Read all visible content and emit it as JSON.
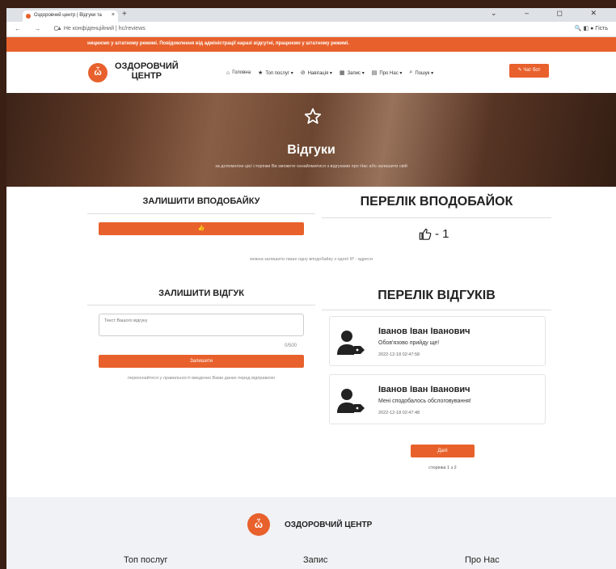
{
  "browser": {
    "tab_title": "Оздоровчий центр | Відгуки та",
    "tab_close": "×",
    "new_tab": "+",
    "window_controls": "⌄ – ◻ ✕",
    "nav_icons": "← → C",
    "url_text": "▲ Не конфіденційний | hc/reviews",
    "right_icons": "🔍 ◧ ● Гість"
  },
  "notice": {
    "text": "ницюємо у штатному режимі.   Повідомлення від адміністрації наразі відсутні, працюємо у штатному режимі."
  },
  "header": {
    "logo_text_line1": "ОЗДОРОВЧИЙ",
    "logo_text_line2": "ЦЕНТР",
    "menu": [
      {
        "icon": "⌂",
        "label": "Головна"
      },
      {
        "icon": "★",
        "label": "Топ послуг ▾"
      },
      {
        "icon": "⊘",
        "label": "Навігація ▾"
      },
      {
        "icon": "▦",
        "label": "Запис ▾"
      },
      {
        "icon": "▤",
        "label": "Про Нас ▾"
      },
      {
        "icon": "⌕",
        "label": "Пошук ▾"
      }
    ],
    "chat_button": "✎ Чат бот"
  },
  "hero": {
    "title": "Відгуки",
    "subtitle": "за допомогою цієї сторінки Ви зможете ознайомитися з відгуками про Нас або залишити свій"
  },
  "likes": {
    "leave_title": "ЗАЛИШИТИ ВПОДОБАЙКУ",
    "list_title": "ПЕРЕЛІК ВПОДОБАЙОК",
    "like_button_icon": "👍",
    "count": "- 1",
    "note": "можна залишити лише одну вподобайку з одної IP - адреси"
  },
  "review_form": {
    "title": "ЗАЛИШИТИ ВІДГУК",
    "placeholder": "Текст Вашого відгуку",
    "counter": "0/500",
    "submit": "Залишити",
    "note": "переконайтеся у правильності введених Вами даних перед відправкою"
  },
  "reviews": {
    "title": "ПЕРЕЛІК ВІДГУКІВ",
    "items": [
      {
        "name": "Іванов Іван Іванович",
        "text": "Обов'язово прийду ще!",
        "date": "2022-12-18 02:47:58"
      },
      {
        "name": "Іванов Іван Іванович",
        "text": "Мені сподобалось обслоговування!",
        "date": "2022-12-18 02:47:48"
      }
    ],
    "more_button": "Далі",
    "pager": "сторінка 1 з 2"
  },
  "footer": {
    "name": "ОЗДОРОВЧИЙ ЦЕНТР",
    "columns": [
      "Топ послуг",
      "Запис",
      "Про Нас"
    ]
  },
  "colors": {
    "accent": "#e8612c"
  }
}
